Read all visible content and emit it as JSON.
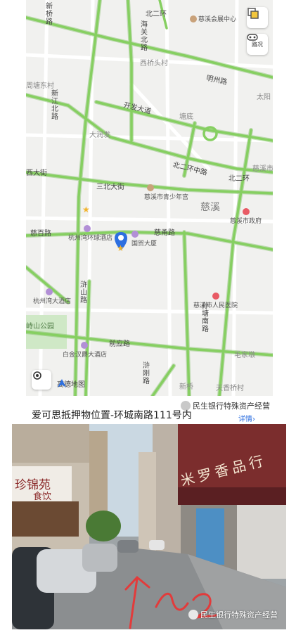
{
  "map": {
    "road_labels": {
      "xinqiao_road": "新桥路",
      "beierhuan_top": "北二环",
      "haiguan_north": "海关北路",
      "mingzhou_road": "明州路",
      "zhouxiu_dongxin": "周塘东村",
      "xinjiang_north": "新江北路",
      "kaifa_avenue": "开发大道",
      "beierhuan_middle": "北二环中路",
      "beierhuan_east": "北二环",
      "xida_street": "西大街",
      "sanbei_street": "三北大街",
      "cibai_road": "慈百路",
      "cifu_road": "慈甬路",
      "hucheng_road": "浒山路",
      "qianying_road": "前应路",
      "xunji_road": "浒刚路",
      "sunyuan_south": "孙塘南路",
      "xingtan_label": "新桥",
      "tianxiang_bridge": "天香桥村",
      "xiqiaotou": "西桥头村",
      "tangdi": "塘底",
      "dazhoufa": "大润发",
      "cixi_city": "慈溪市",
      "maopu": "毛家墩",
      "cixi_big": "慈溪",
      "taian": "太阳"
    },
    "pois": {
      "convention": "慈溪会展中心",
      "youth_palace": "慈溪市青少年宫",
      "gov": "慈溪市政府",
      "hotel_hzw": "杭州湾环球酒店",
      "guomao": "国贸大厦",
      "hzw_hotel": "杭州湾大酒店",
      "hospital": "慈溪市人民医院",
      "park": "峙山公园",
      "baijin": "白金汉爵大酒店"
    },
    "brand": "高德地图",
    "traffic_button_label": "路况",
    "layer_icon": "layers-icon",
    "locate_icon": "locate-icon",
    "colors": {
      "road_green": "#86cf61",
      "road_white": "#ffffff",
      "marker_blue": "#2d6fe0",
      "hospital_red": "#e85a64"
    }
  },
  "caption": "爱可思抵押物位置-环城南路111号内",
  "watermark_top": "民生银行特殊资产经营",
  "watermark_bottom": "民生银行特殊资产经营",
  "detail_link": "详情",
  "photo": {
    "store_sign": "米罗香品行",
    "left_sign": "珍锦苑",
    "left_sign2": "食饮"
  }
}
